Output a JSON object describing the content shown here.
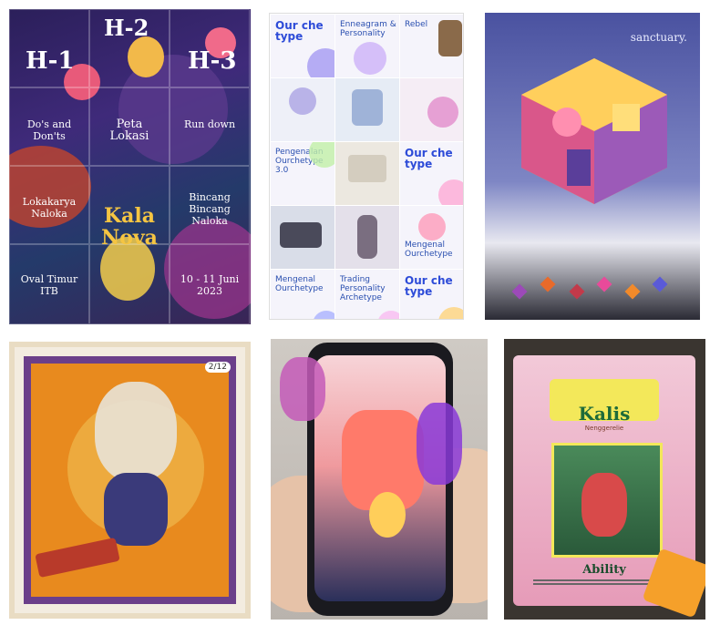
{
  "posters": {
    "grid": {
      "h1": "H-1",
      "h2": "H-2",
      "h3": "H-3",
      "dos": "Do's and Don'ts",
      "peta": "Peta Lokasi",
      "rundown": "Run down",
      "lokakarya": "Lokakarya Naloka",
      "kalanova": "Kala Nova",
      "bincang": "Bincang Bincang Naloka",
      "place": "Oval Timur ITB",
      "date": "10 - 11 Juni 2023"
    },
    "instagram": {
      "tiles": [
        "Our che type",
        "Enneagram & Personality",
        "Rebel",
        "",
        "",
        "",
        "Pengenalan Ourchetype 3.0",
        "",
        "Our che type",
        "",
        "",
        "Mengenal Ourchetype",
        "Mengenal Ourchetype",
        "Trading Personality Archetype",
        "Our che type"
      ]
    },
    "sanctuary": {
      "title": "sanctuary."
    },
    "tarot": {
      "number": "2/12"
    },
    "card": {
      "name": "Kalis",
      "subtitle": "Nenggerelie",
      "ability": "Ability"
    }
  },
  "colors": {
    "festival_bg": "#2b1f5a",
    "ig_blue": "#2d4bd8",
    "sanctuary_bg": "#4a52a0",
    "tarot_orange": "#e88a1e",
    "tarot_purple": "#6b3f8a",
    "card_pink": "#e69bb8",
    "card_green": "#1e6b3a"
  }
}
